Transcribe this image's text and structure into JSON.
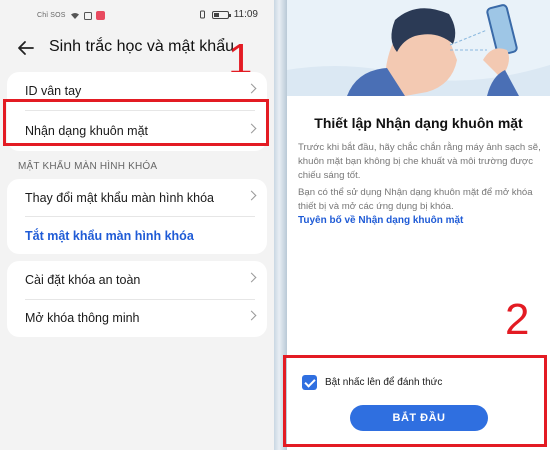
{
  "left": {
    "status": {
      "carrier": "Chỉ SOS",
      "time": "11:09"
    },
    "header": {
      "title": "Sinh trắc học và mật khẩu"
    },
    "annotations": {
      "step1": "1",
      "step2": "2"
    },
    "card1": [
      {
        "label": "ID vân tay"
      },
      {
        "label": "Nhận dạng khuôn mặt"
      }
    ],
    "section_header": "MẬT KHẨU MÀN HÌNH KHÓA",
    "card2": [
      {
        "label": "Thay đổi mật khẩu màn hình khóa"
      },
      {
        "label": "Tắt mật khẩu màn hình khóa"
      }
    ],
    "card3": [
      {
        "label": "Cài đặt khóa an toàn"
      },
      {
        "label": "Mở khóa thông minh"
      }
    ]
  },
  "right": {
    "title": "Thiết lập Nhận dạng khuôn mặt",
    "paragraph1": "Trước khi bắt đầu, hãy chắc chắn rằng máy ảnh sạch sẽ, khuôn mặt bạn không bị che khuất và môi trường được chiếu sáng tốt.",
    "paragraph2": "Bạn có thể sử dụng Nhận dạng khuôn mặt để mở khóa thiết bị và mở các ứng dụng bị khóa.",
    "link": "Tuyên bố về Nhận dạng khuôn mặt",
    "checkbox_label": "Bật nhấc lên để đánh thức",
    "checkbox_checked": true,
    "start_button": "BẮT ĐẦU"
  },
  "colors": {
    "accent": "#2f6fe0",
    "link": "#1f5bd6",
    "highlight": "#e31b23"
  }
}
